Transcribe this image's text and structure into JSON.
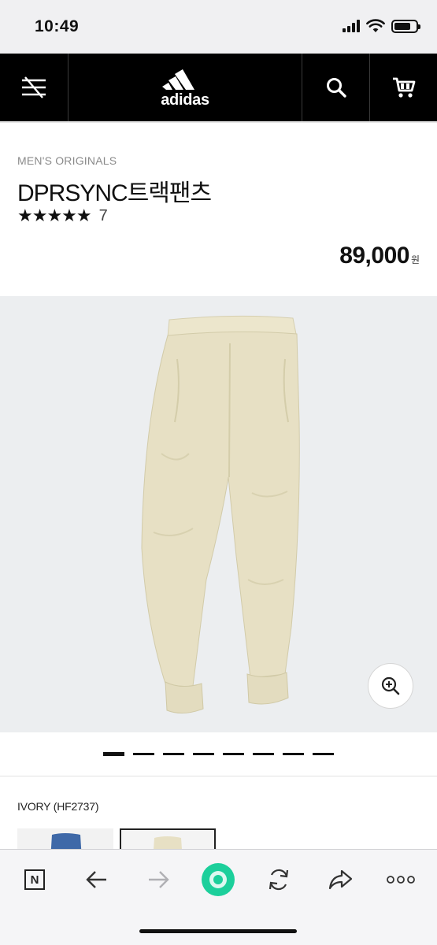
{
  "status_bar": {
    "time": "10:49",
    "battery_level": 0.75
  },
  "nav": {
    "brand": "adidas",
    "icons": [
      "menu-icon",
      "adidas-logo",
      "search-icon",
      "cart-icon"
    ]
  },
  "product": {
    "category": "MEN'S ORIGINALS",
    "title": "DPRSYNC트랙팬츠",
    "stars": "★★★★★",
    "rating_value": 5,
    "review_count": "7",
    "price": "89,000",
    "currency": "원"
  },
  "gallery": {
    "slide_count": 8,
    "active_slide": 1
  },
  "color": {
    "label": "IVORY (HF2737)",
    "selected_index": 1,
    "swatches": [
      "blue",
      "ivory"
    ]
  },
  "toolbar": {
    "n_label": "N",
    "items": [
      "n-icon",
      "back-arrow-icon",
      "forward-arrow-icon",
      "home-icon",
      "refresh-icon",
      "share-icon",
      "more-icon"
    ]
  },
  "colors": {
    "nav_bg": "#000000",
    "gallery_bg": "#eceef0",
    "pants": "#e7e0c4",
    "toolbar_home": "#1ccf9b"
  }
}
